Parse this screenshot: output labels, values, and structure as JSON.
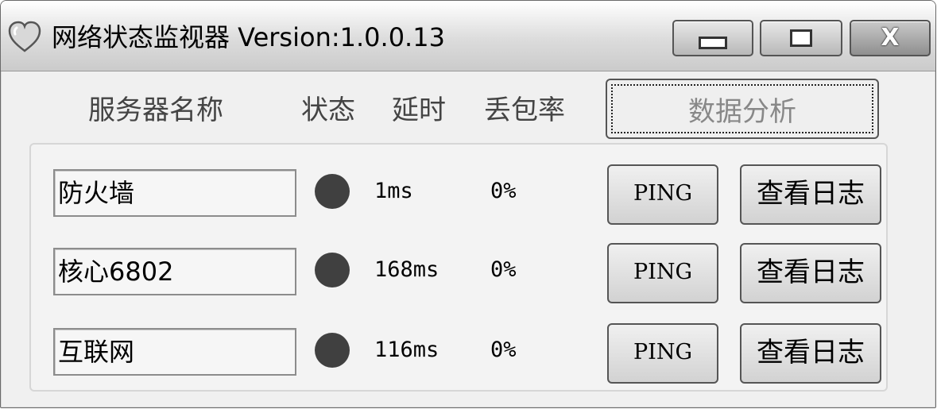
{
  "window": {
    "title": "网络状态监视器 Version:1.0.0.13",
    "controls": {
      "minimize": "minimize",
      "maximize": "maximize",
      "close": "X"
    }
  },
  "header": {
    "server_name": "服务器名称",
    "status": "状态",
    "delay": "延时",
    "packet_loss": "丢包率",
    "analyze_button": "数据分析"
  },
  "servers": [
    {
      "name": "防火墙",
      "status_color": "#404040",
      "delay": "1ms",
      "loss": "0%",
      "ping_label": "PING",
      "log_label": "查看日志"
    },
    {
      "name": "核心6802",
      "status_color": "#404040",
      "delay": "168ms",
      "loss": "0%",
      "ping_label": "PING",
      "log_label": "查看日志"
    },
    {
      "name": "互联网",
      "status_color": "#404040",
      "delay": "116ms",
      "loss": "0%",
      "ping_label": "PING",
      "log_label": "查看日志"
    }
  ],
  "icons": {
    "app": "heart-icon"
  }
}
